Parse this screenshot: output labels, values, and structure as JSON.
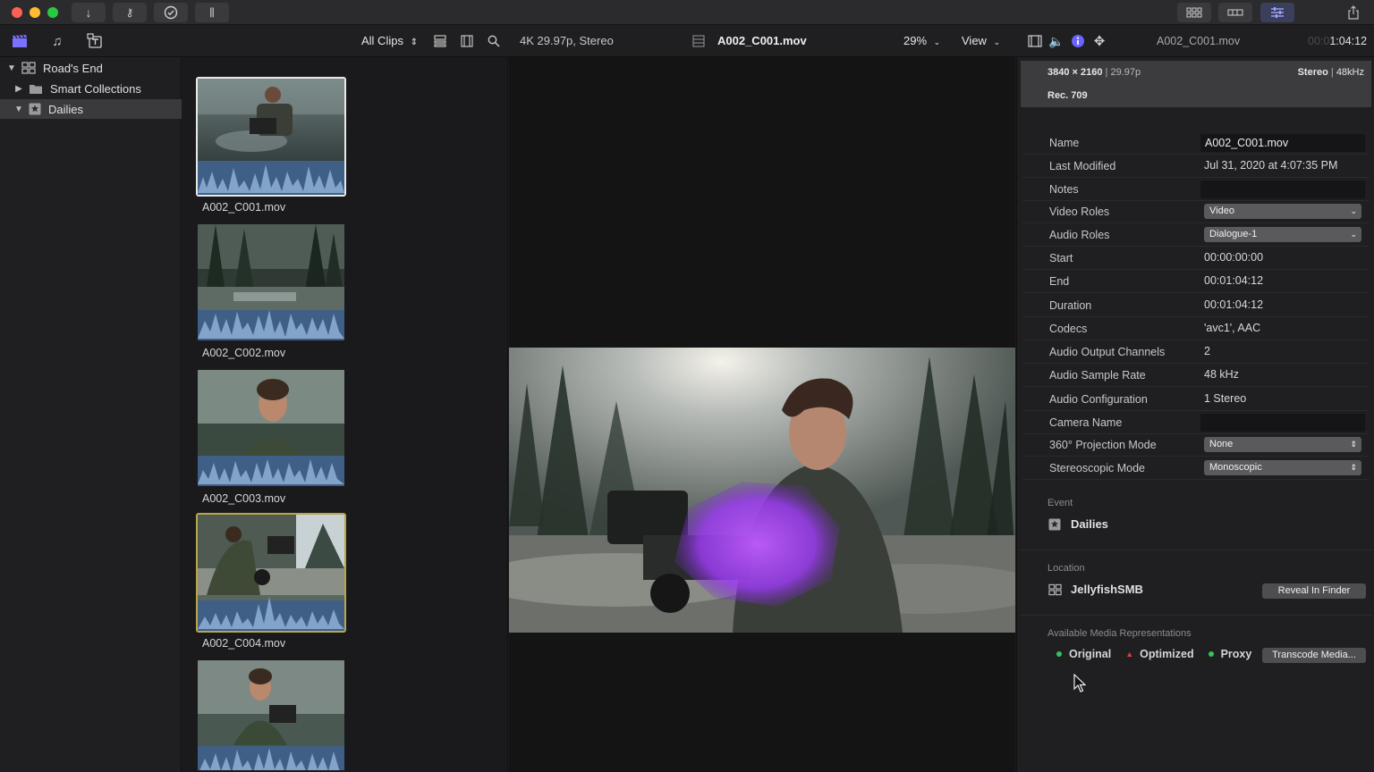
{
  "colors": {
    "accent": "#8f86ff",
    "purple_flare": "#b44cff",
    "dot_green": "#3cc15a",
    "dot_red": "#e03c3c"
  },
  "titlebar": {
    "left_buttons": [
      "download-icon",
      "key-icon",
      "checkmark-icon",
      "audio-meter-icon"
    ],
    "right_buttons": [
      "grid-view-icon",
      "timeline-view-icon",
      "inspector-adjust-icon"
    ],
    "share_icon": "share-icon"
  },
  "toolbar": {
    "filter_label": "All Clips",
    "filter_arrow": "⌃⌄",
    "format_info": "4K 29.97p, Stereo",
    "clip_name": "A002_C001.mov",
    "zoom": "29%",
    "view_label": "View",
    "inspector_clip_name": "A002_C001.mov",
    "timecode_dim": "00:0",
    "timecode": "1:04:12"
  },
  "sidebar": {
    "items": [
      {
        "label": "Road's End",
        "icon": "library-icon",
        "expanded": true
      },
      {
        "label": "Smart Collections",
        "icon": "folder-icon",
        "expanded": false
      },
      {
        "label": "Dailies",
        "icon": "event-star-icon",
        "expanded": true
      }
    ]
  },
  "browser": {
    "clips": [
      {
        "name": "A002_C001.mov"
      },
      {
        "name": "A002_C002.mov"
      },
      {
        "name": "A002_C003.mov"
      },
      {
        "name": "A002_C004.mov"
      },
      {
        "name": ""
      }
    ]
  },
  "inspector": {
    "resolution": "3840 × 2160",
    "fps": "29.97p",
    "audio_info": "Stereo",
    "sample": "48kHz",
    "color_space": "Rec. 709",
    "properties": [
      {
        "label": "Name",
        "value": "A002_C001.mov",
        "kind": "field"
      },
      {
        "label": "Last Modified",
        "value": "Jul 31, 2020 at 4:07:35 PM",
        "kind": "text"
      },
      {
        "label": "Notes",
        "value": "",
        "kind": "field"
      },
      {
        "label": "Video Roles",
        "value": "Video",
        "kind": "select"
      },
      {
        "label": "Audio Roles",
        "value": "Dialogue-1",
        "kind": "select"
      },
      {
        "label": "Start",
        "value": "00:00:00:00",
        "kind": "text"
      },
      {
        "label": "End",
        "value": "00:01:04:12",
        "kind": "text"
      },
      {
        "label": "Duration",
        "value": "00:01:04:12",
        "kind": "text"
      },
      {
        "label": "Codecs",
        "value": "'avc1', AAC",
        "kind": "text"
      },
      {
        "label": "Audio Output Channels",
        "value": "2",
        "kind": "text"
      },
      {
        "label": "Audio Sample Rate",
        "value": "48 kHz",
        "kind": "text"
      },
      {
        "label": "Audio Configuration",
        "value": "1 Stereo",
        "kind": "text"
      },
      {
        "label": "Camera Name",
        "value": "",
        "kind": "field"
      },
      {
        "label": "360° Projection Mode",
        "value": "None",
        "kind": "stepper"
      },
      {
        "label": "Stereoscopic Mode",
        "value": "Monoscopic",
        "kind": "stepper"
      }
    ],
    "event_label": "Event",
    "event_name": "Dailies",
    "location_label": "Location",
    "location_name": "JellyfishSMB",
    "reveal_button": "Reveal In Finder",
    "media_label": "Available Media Representations",
    "media": [
      {
        "label": "Original",
        "status": "green"
      },
      {
        "label": "Optimized",
        "status": "red"
      },
      {
        "label": "Proxy",
        "status": "green"
      }
    ],
    "transcode_button": "Transcode Media..."
  }
}
